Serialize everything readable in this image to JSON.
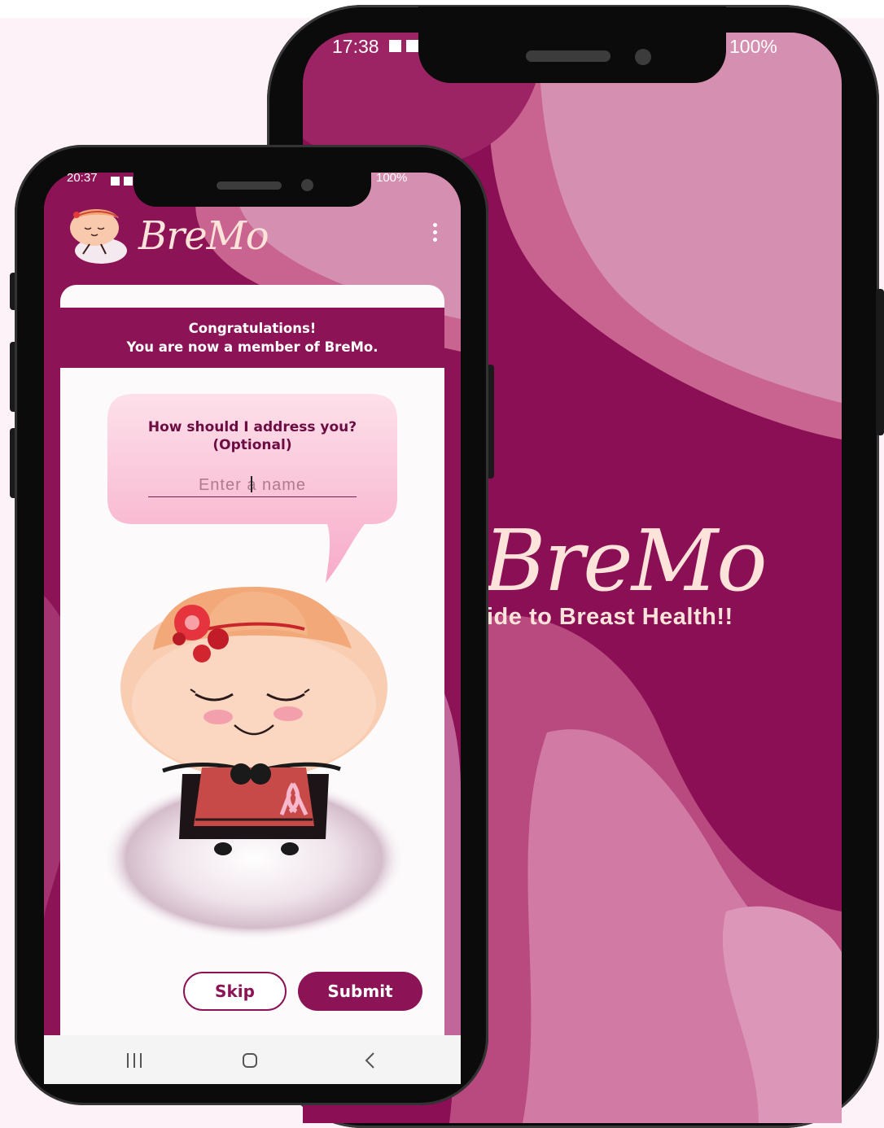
{
  "colors": {
    "primary": "#8c1456",
    "pink_light": "#f7c0d8",
    "cream": "#fde3d9",
    "background": "#fdf2f7"
  },
  "back_phone": {
    "status_time": "17:38",
    "status_battery": "100%",
    "logo_text": "BreMo",
    "tagline": "ide to Breast Health!!"
  },
  "front_phone": {
    "status_time": "20:37",
    "status_battery": "100%",
    "app_title": "BreMo",
    "menu_icon": "more-vert-icon",
    "header": {
      "line1": "Congratulations!",
      "line2": "You are now a member of BreMo."
    },
    "prompt": {
      "line1": "How should I address you?",
      "line2": "(Optional)"
    },
    "name_field": {
      "placeholder": "Enter a name",
      "value": ""
    },
    "buttons": {
      "skip": "Skip",
      "submit": "Submit"
    },
    "nav": {
      "recents_icon": "recents-icon",
      "home_icon": "home-icon",
      "back_icon": "back-icon"
    }
  }
}
